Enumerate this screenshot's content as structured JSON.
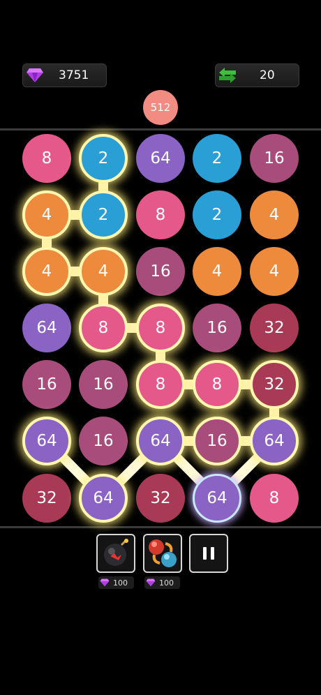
{
  "header": {
    "gems": "3751",
    "swaps": "20",
    "target": "512"
  },
  "colors": {
    "2": "#2a9fd6",
    "4": "#ee8a3c",
    "8": "#e5588a",
    "16": "#a84c7c",
    "32": "#a83a56",
    "64": "#8a63c4"
  },
  "grid": [
    [
      "8",
      "2",
      "64",
      "2",
      "16"
    ],
    [
      "4",
      "2",
      "8",
      "2",
      "4"
    ],
    [
      "4",
      "4",
      "16",
      "4",
      "4"
    ],
    [
      "64",
      "8",
      "8",
      "16",
      "32"
    ],
    [
      "16",
      "16",
      "8",
      "8",
      "32"
    ],
    [
      "64",
      "16",
      "64",
      "16",
      "64"
    ],
    [
      "32",
      "64",
      "32",
      "64",
      "8"
    ]
  ],
  "chain": [
    [
      1,
      1
    ],
    [
      0,
      1
    ],
    [
      0,
      2
    ],
    [
      1,
      2
    ],
    [
      1,
      3
    ],
    [
      2,
      3
    ],
    [
      2,
      4
    ],
    [
      3,
      4
    ],
    [
      3,
      5
    ],
    [
      4,
      4
    ],
    [
      4,
      5
    ],
    [
      4,
      6
    ],
    [
      3,
      5
    ],
    [
      2,
      5
    ],
    [
      1,
      6
    ],
    [
      0,
      5
    ],
    [
      2,
      6
    ],
    [
      3,
      6
    ]
  ],
  "tools": {
    "bomb_icon": "bomb-icon",
    "swap_icon": "swap-balls-icon",
    "pause_icon": "pause-icon",
    "bomb_cost": "100",
    "swap_cost": "100"
  }
}
